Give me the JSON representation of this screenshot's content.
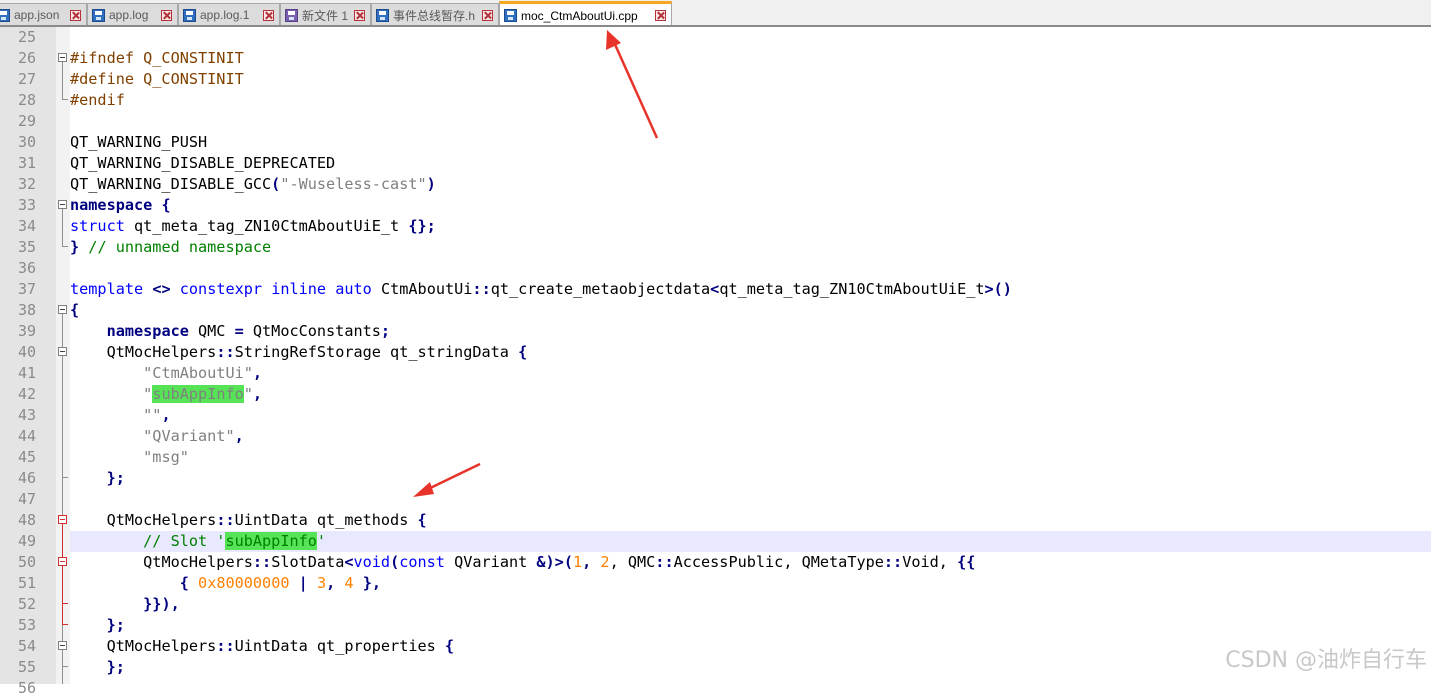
{
  "tabs": [
    {
      "label": "app.json",
      "icon": "save-icon",
      "active": false
    },
    {
      "label": "app.log",
      "icon": "save-icon",
      "active": false
    },
    {
      "label": "app.log.1",
      "icon": "save-icon",
      "active": false
    },
    {
      "label": "新文件 1",
      "icon": "save-icon-purple",
      "active": false
    },
    {
      "label": "事件总线暂存.h",
      "icon": "save-icon",
      "active": false
    },
    {
      "label": "moc_CtmAboutUi.cpp",
      "icon": "save-icon",
      "active": true
    }
  ],
  "editor": {
    "current_line": 49,
    "lines": [
      {
        "n": "25"
      },
      {
        "n": "26",
        "t": {
          "pp1": "#ifndef Q_CONSTINIT"
        }
      },
      {
        "n": "27",
        "t": {
          "pp1": "#define Q_CONSTINIT"
        }
      },
      {
        "n": "28",
        "t": {
          "pp1": "#endif"
        }
      },
      {
        "n": "29"
      },
      {
        "n": "30",
        "t": {
          "a": "QT_WARNING_PUSH"
        }
      },
      {
        "n": "31",
        "t": {
          "a": "QT_WARNING_DISABLE_DEPRECATED"
        }
      },
      {
        "n": "32",
        "t": {
          "a": "QT_WARNING_DISABLE_GCC",
          "b": "(",
          "c": "\"-Wuseless-cast\"",
          "d": ")"
        }
      },
      {
        "n": "33",
        "t": {
          "a": "namespace",
          "b": " ",
          "c": "{"
        }
      },
      {
        "n": "34",
        "t": {
          "a": "struct",
          "b": " qt_meta_tag_ZN10CtmAboutUiE_t ",
          "c": "{};"
        }
      },
      {
        "n": "35",
        "t": {
          "a": "}",
          "b": " // unnamed namespace"
        }
      },
      {
        "n": "36"
      },
      {
        "n": "37",
        "t": {
          "a": "template",
          "b": " ",
          "c": "<>",
          "d": " ",
          "e": "constexpr",
          "f": " ",
          "g": "inline",
          "h": " ",
          "i": "auto",
          "j": " CtmAboutUi",
          "k": "::",
          "l": "qt_create_metaobjectdata",
          "m": "<",
          "o": "qt_meta_tag_ZN10CtmAboutUiE_t",
          "p": ">()"
        }
      },
      {
        "n": "38",
        "t": {
          "a": "{"
        }
      },
      {
        "n": "39",
        "t": {
          "i": "    ",
          "a": "namespace",
          "b": " QMC ",
          "c": "=",
          "d": " QtMocConstants",
          "e": ";"
        }
      },
      {
        "n": "40",
        "t": {
          "i": "    ",
          "a": "QtMocHelpers",
          "b": "::",
          "c": "StringRefStorage qt_stringData ",
          "d": "{"
        }
      },
      {
        "n": "41",
        "t": {
          "i": "        ",
          "a": "\"CtmAboutUi\"",
          "b": ","
        }
      },
      {
        "n": "42",
        "t": {
          "i": "        ",
          "a": "\"",
          "h": "subAppInfo",
          "c": "\"",
          "b": ","
        }
      },
      {
        "n": "43",
        "t": {
          "i": "        ",
          "a": "\"\"",
          "b": ","
        }
      },
      {
        "n": "44",
        "t": {
          "i": "        ",
          "a": "\"QVariant\"",
          "b": ","
        }
      },
      {
        "n": "45",
        "t": {
          "i": "        ",
          "a": "\"msg\""
        }
      },
      {
        "n": "46",
        "t": {
          "i": "    ",
          "a": "};"
        }
      },
      {
        "n": "47"
      },
      {
        "n": "48",
        "t": {
          "i": "    ",
          "a": "QtMocHelpers",
          "b": "::",
          "c": "UintData qt_methods ",
          "d": "{"
        }
      },
      {
        "n": "49",
        "t": {
          "i": "        ",
          "a": "// Slot '",
          "h": "subAppInfo",
          "c": "'"
        }
      },
      {
        "n": "50",
        "t": {
          "i": "        ",
          "a": "QtMocHelpers",
          "b": "::",
          "c": "SlotData",
          "d": "<",
          "e": "void",
          "f": "(",
          "g": "const",
          "j": " QVariant ",
          "k": "&)>(",
          "l": "1",
          "m": ", ",
          "o": "2",
          "p": ", QMC",
          "q": "::",
          "r": "AccessPublic, QMetaType",
          "s": "::",
          "u": "Void, ",
          "v": "{{"
        }
      },
      {
        "n": "51",
        "t": {
          "i": "            ",
          "a": "{",
          "b": " ",
          "c": "0x80000000",
          "d": " ",
          "e": "|",
          "f": " ",
          "g": "3",
          "j": ", ",
          "k": "4",
          "l": " ",
          "m": "},"
        }
      },
      {
        "n": "52",
        "t": {
          "i": "        ",
          "a": "}}),"
        }
      },
      {
        "n": "53",
        "t": {
          "i": "    ",
          "a": "};"
        }
      },
      {
        "n": "54",
        "t": {
          "i": "    ",
          "a": "QtMocHelpers",
          "b": "::",
          "c": "UintData qt_properties ",
          "d": "{"
        }
      },
      {
        "n": "55",
        "t": {
          "i": "    ",
          "a": "};"
        }
      },
      {
        "n": "56"
      }
    ]
  },
  "watermark": "CSDN @油炸自行车",
  "colors": {
    "preprocessor": "#804000",
    "keyword": "#0000ff",
    "keyword_bold": "#000080",
    "string": "#808080",
    "comment": "#008000",
    "number": "#ff8000",
    "highlight": "#56e356",
    "current_line": "#e8e8ff",
    "active_tab_accent": "#f5a623",
    "annotation_arrow": "#e8332a"
  }
}
